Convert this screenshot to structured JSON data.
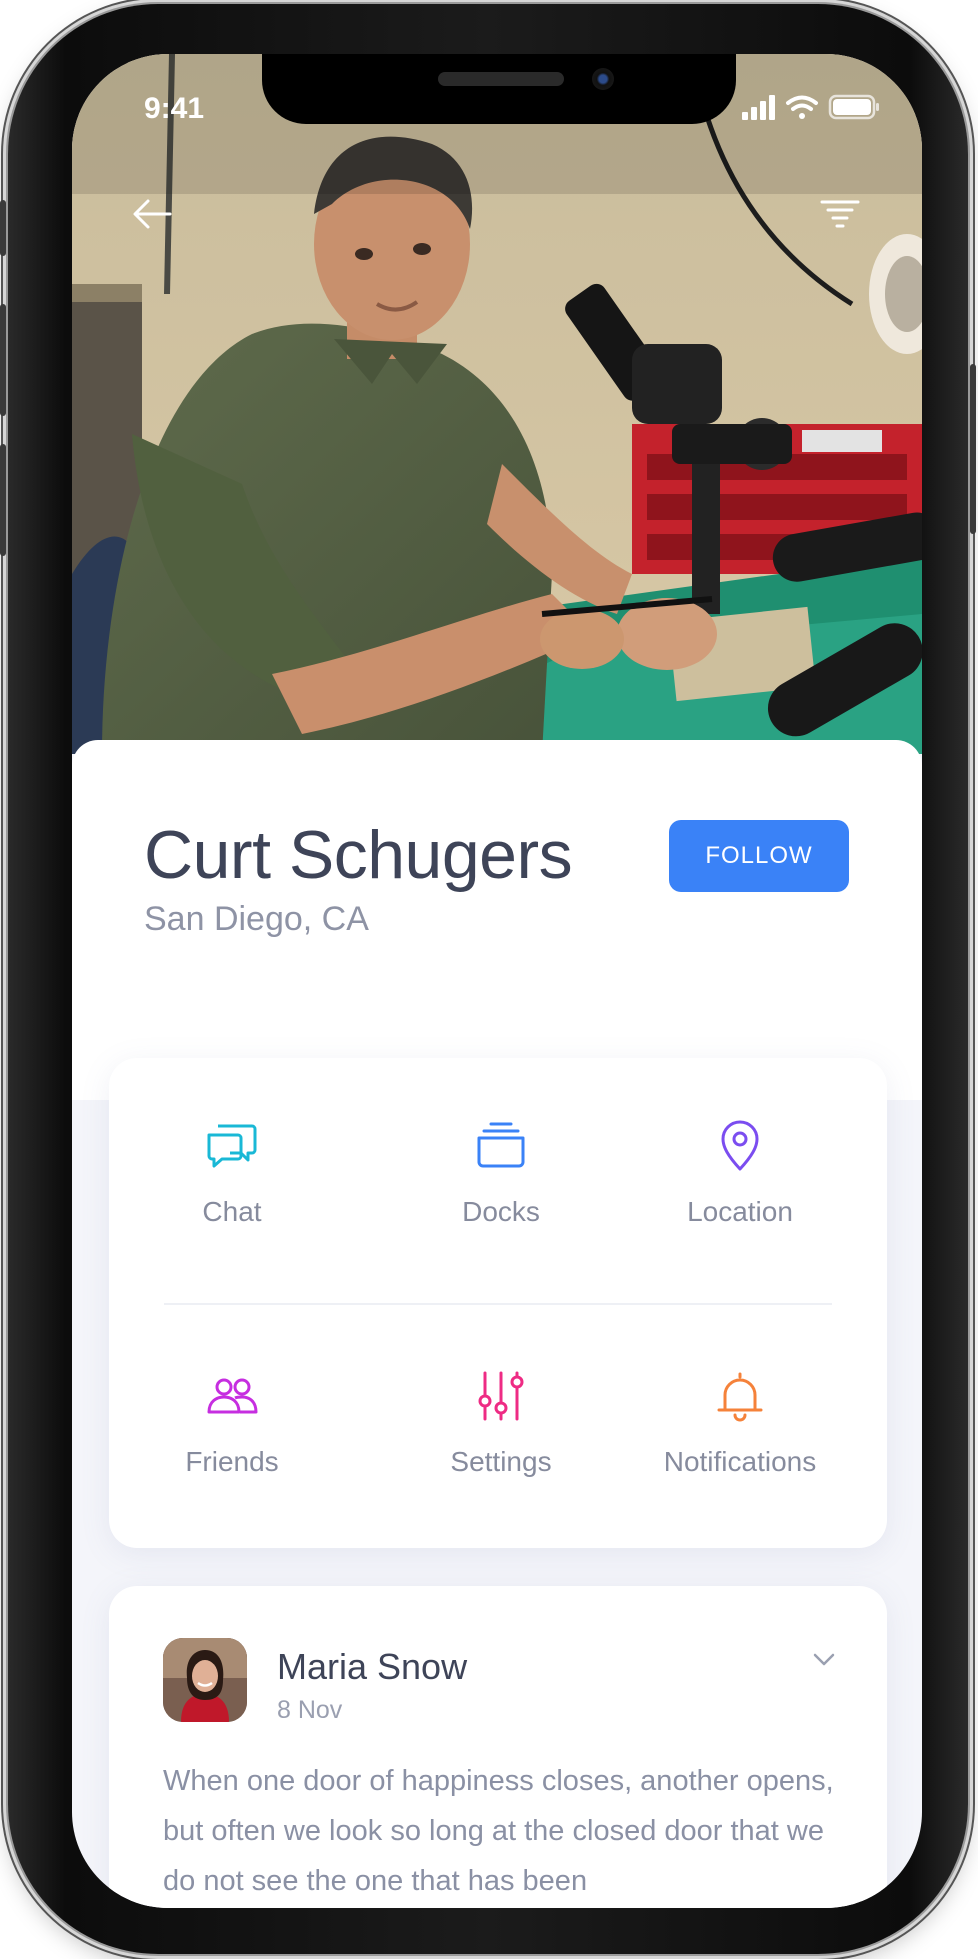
{
  "status_bar": {
    "time": "9:41"
  },
  "profile": {
    "name": "Curt Schugers",
    "location": "San Diego, CA",
    "follow_label": "FOLLOW"
  },
  "menu": {
    "items": [
      {
        "label": "Chat",
        "icon": "chat-icon",
        "color": "#19b8d6"
      },
      {
        "label": "Docks",
        "icon": "docks-icon",
        "color": "#3a82f7"
      },
      {
        "label": "Location",
        "icon": "location-pin-icon",
        "color": "#7b4df0"
      },
      {
        "label": "Friends",
        "icon": "friends-icon",
        "color": "#c62ee0"
      },
      {
        "label": "Settings",
        "icon": "settings-sliders-icon",
        "color": "#ee2b84"
      },
      {
        "label": "Notifications",
        "icon": "bell-icon",
        "color": "#f5823a"
      }
    ]
  },
  "post": {
    "author": "Maria Snow",
    "date": "8 Nov",
    "text": "When one door of happiness closes, another opens, but often we look so long at the closed door that we do not see the one that has been"
  },
  "colors": {
    "accent": "#3a82f7",
    "text_dark": "#3e4458",
    "text_muted": "#868b9d"
  }
}
